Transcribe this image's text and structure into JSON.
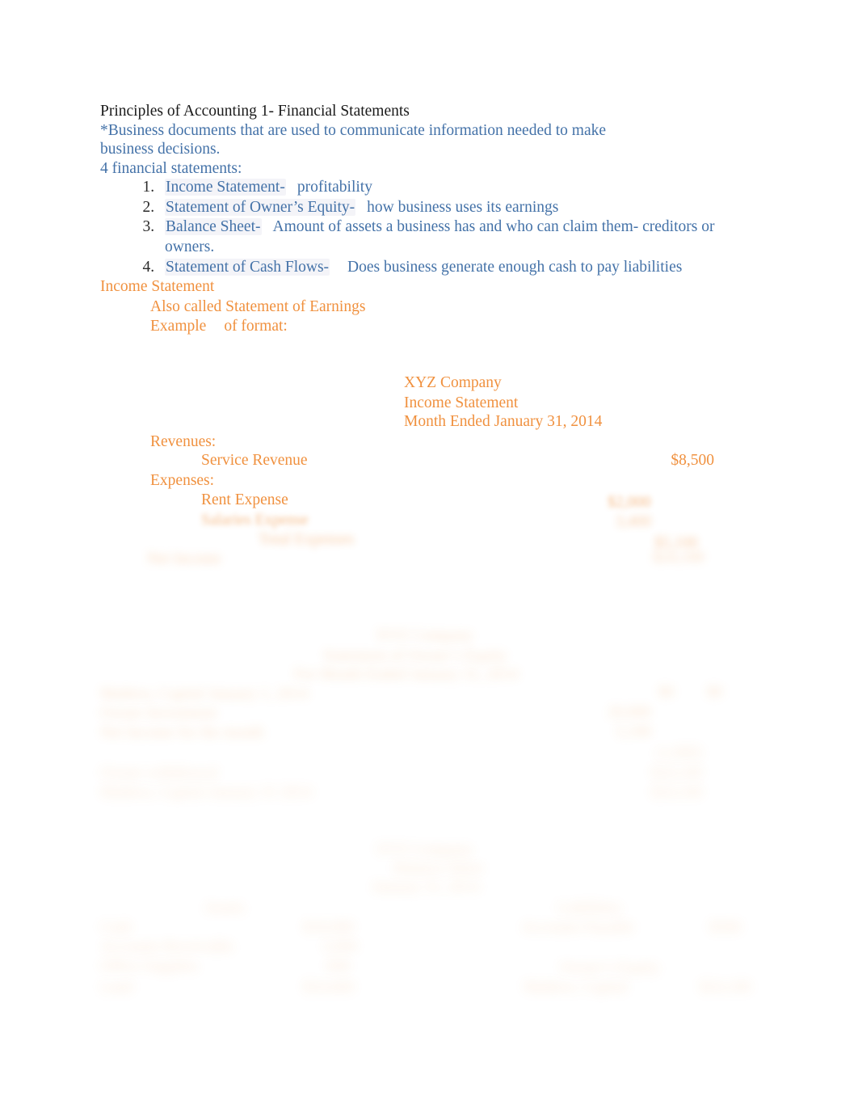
{
  "document": {
    "title": "Principles of Accounting 1- Financial Statements",
    "intro_line_1": "*Business documents that are used to communicate information needed to make",
    "intro_line_2": "business decisions.",
    "list_heading": "4 financial statements:",
    "statements_list": [
      {
        "term": "Income Statement-",
        "definition": "profitability"
      },
      {
        "term": "Statement of Owner’s Equity-",
        "definition": "how business uses its earnings"
      },
      {
        "term": "Balance Sheet-",
        "definition": "Amount of assets a business has and who can claim them-",
        "continuation": "creditors or owners."
      },
      {
        "term": "Statement of Cash Flows-",
        "definition": "Does business generate enough cash to pay",
        "continuation": "liabilities"
      }
    ],
    "section": {
      "heading": "Income Statement",
      "alt_name": "Also called Statement of Earnings",
      "example_label": "Example",
      "example_label_suffix": "of format:"
    },
    "income_statement_example": {
      "company": "XYZ Company",
      "statement_name": "Income Statement",
      "period": "Month Ended January 31, 2014",
      "revenues_label": "Revenues:",
      "revenue_item": "Service Revenue",
      "revenue_amount": "$8,500",
      "expenses_label": "Expenses:",
      "expense_item_1": "Rent Expense"
    },
    "faded_blocks": {
      "note": "Remaining content on the page is blurred and illegible",
      "income_tail": [
        {
          "text": "Salaries Expense",
          "amount": "$2,000"
        },
        {
          "text": "Total Expenses",
          "amount": "3,400"
        },
        {
          "text": "Net Income",
          "amount": "$5,100"
        }
      ],
      "owners_equity": {
        "company": "XYZ Company",
        "statement_name": "Statement of Owner’s Equity",
        "period": "For Month Ended January 31, 2014",
        "rows": [
          {
            "text": "Mathew, Capital January 1, 2014",
            "amount": "$0"
          },
          {
            "text": "Owner Investment",
            "amount": "20,000"
          },
          {
            "text": "Net Income for the month",
            "amount": "5,100"
          },
          {
            "text": "Owner withdrawal",
            "amount": "(1,000)"
          },
          {
            "text": "Mathew, Capital January 31 2014",
            "amount": "$24,100"
          }
        ]
      },
      "balance_sheet": {
        "company": "XYZ Company",
        "statement_name": "Balance Sheet",
        "period": "January 31, 2014",
        "assets_label": "Assets",
        "liabilities_label": "Liabilities",
        "assets": [
          {
            "text": "Cash",
            "amount": "$18,000"
          },
          {
            "text": "Accounts Receivable",
            "amount": "3,000"
          },
          {
            "text": "Office Supplies",
            "amount": "600"
          },
          {
            "text": "Land",
            "amount": "$24,600"
          }
        ],
        "liabilities": [
          {
            "text": "Accounts Payable",
            "amount": "$500"
          }
        ],
        "owners_equity": [
          {
            "text": "Owner’s Equity",
            "amount": ""
          },
          {
            "text": "Mathew, Capital",
            "amount": "$24,100"
          }
        ]
      }
    }
  }
}
